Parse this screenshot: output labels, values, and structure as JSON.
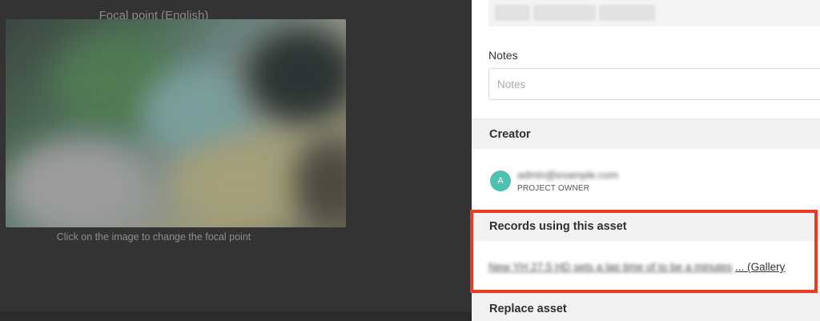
{
  "focal_panel": {
    "title": "Focal point (English)",
    "hint": "Click on the image to change the focal point"
  },
  "notes": {
    "label": "Notes",
    "placeholder": "Notes"
  },
  "creator": {
    "header": "Creator",
    "avatar_letter": "A",
    "email": "admin@example.com",
    "role": "PROJECT OWNER"
  },
  "records": {
    "header": "Records using this asset",
    "link_text": "New YH 27.5 HD sets a lap time of to be a minutes",
    "gallery_suffix": "... (Gallery"
  },
  "replace": {
    "header": "Replace asset"
  },
  "colors": {
    "highlight": "#ea3c24",
    "avatar": "#4ec2b0",
    "left_panel": "#333333"
  }
}
